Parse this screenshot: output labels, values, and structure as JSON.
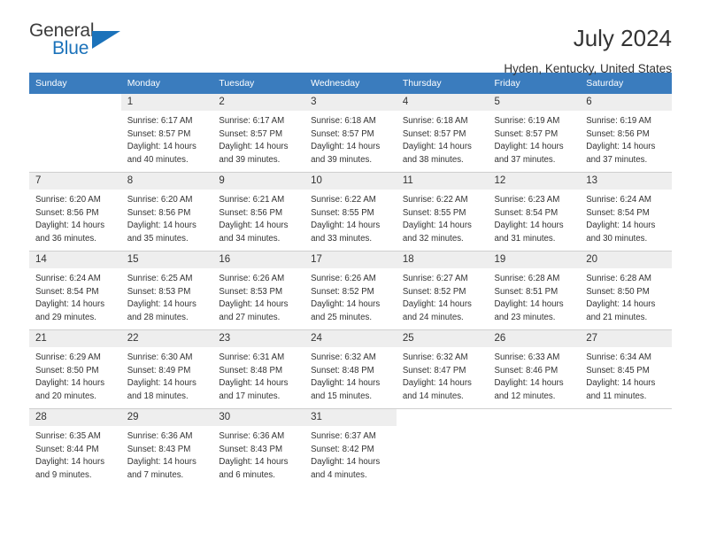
{
  "brand": {
    "name_part1": "General",
    "name_part2": "Blue",
    "triangle_color": "#1b72ba"
  },
  "header": {
    "title": "July 2024",
    "subtitle": "Hyden, Kentucky, United States"
  },
  "theme": {
    "header_bar_color": "#3a7cbe",
    "daynum_bg": "#eeeeee",
    "text_color": "#333333"
  },
  "weekday_headers": [
    "Sunday",
    "Monday",
    "Tuesday",
    "Wednesday",
    "Thursday",
    "Friday",
    "Saturday"
  ],
  "weeks": [
    [
      {
        "day": "",
        "sunrise": "",
        "sunset": "",
        "daylight1": "",
        "daylight2": ""
      },
      {
        "day": "1",
        "sunrise": "Sunrise: 6:17 AM",
        "sunset": "Sunset: 8:57 PM",
        "daylight1": "Daylight: 14 hours",
        "daylight2": "and 40 minutes."
      },
      {
        "day": "2",
        "sunrise": "Sunrise: 6:17 AM",
        "sunset": "Sunset: 8:57 PM",
        "daylight1": "Daylight: 14 hours",
        "daylight2": "and 39 minutes."
      },
      {
        "day": "3",
        "sunrise": "Sunrise: 6:18 AM",
        "sunset": "Sunset: 8:57 PM",
        "daylight1": "Daylight: 14 hours",
        "daylight2": "and 39 minutes."
      },
      {
        "day": "4",
        "sunrise": "Sunrise: 6:18 AM",
        "sunset": "Sunset: 8:57 PM",
        "daylight1": "Daylight: 14 hours",
        "daylight2": "and 38 minutes."
      },
      {
        "day": "5",
        "sunrise": "Sunrise: 6:19 AM",
        "sunset": "Sunset: 8:57 PM",
        "daylight1": "Daylight: 14 hours",
        "daylight2": "and 37 minutes."
      },
      {
        "day": "6",
        "sunrise": "Sunrise: 6:19 AM",
        "sunset": "Sunset: 8:56 PM",
        "daylight1": "Daylight: 14 hours",
        "daylight2": "and 37 minutes."
      }
    ],
    [
      {
        "day": "7",
        "sunrise": "Sunrise: 6:20 AM",
        "sunset": "Sunset: 8:56 PM",
        "daylight1": "Daylight: 14 hours",
        "daylight2": "and 36 minutes."
      },
      {
        "day": "8",
        "sunrise": "Sunrise: 6:20 AM",
        "sunset": "Sunset: 8:56 PM",
        "daylight1": "Daylight: 14 hours",
        "daylight2": "and 35 minutes."
      },
      {
        "day": "9",
        "sunrise": "Sunrise: 6:21 AM",
        "sunset": "Sunset: 8:56 PM",
        "daylight1": "Daylight: 14 hours",
        "daylight2": "and 34 minutes."
      },
      {
        "day": "10",
        "sunrise": "Sunrise: 6:22 AM",
        "sunset": "Sunset: 8:55 PM",
        "daylight1": "Daylight: 14 hours",
        "daylight2": "and 33 minutes."
      },
      {
        "day": "11",
        "sunrise": "Sunrise: 6:22 AM",
        "sunset": "Sunset: 8:55 PM",
        "daylight1": "Daylight: 14 hours",
        "daylight2": "and 32 minutes."
      },
      {
        "day": "12",
        "sunrise": "Sunrise: 6:23 AM",
        "sunset": "Sunset: 8:54 PM",
        "daylight1": "Daylight: 14 hours",
        "daylight2": "and 31 minutes."
      },
      {
        "day": "13",
        "sunrise": "Sunrise: 6:24 AM",
        "sunset": "Sunset: 8:54 PM",
        "daylight1": "Daylight: 14 hours",
        "daylight2": "and 30 minutes."
      }
    ],
    [
      {
        "day": "14",
        "sunrise": "Sunrise: 6:24 AM",
        "sunset": "Sunset: 8:54 PM",
        "daylight1": "Daylight: 14 hours",
        "daylight2": "and 29 minutes."
      },
      {
        "day": "15",
        "sunrise": "Sunrise: 6:25 AM",
        "sunset": "Sunset: 8:53 PM",
        "daylight1": "Daylight: 14 hours",
        "daylight2": "and 28 minutes."
      },
      {
        "day": "16",
        "sunrise": "Sunrise: 6:26 AM",
        "sunset": "Sunset: 8:53 PM",
        "daylight1": "Daylight: 14 hours",
        "daylight2": "and 27 minutes."
      },
      {
        "day": "17",
        "sunrise": "Sunrise: 6:26 AM",
        "sunset": "Sunset: 8:52 PM",
        "daylight1": "Daylight: 14 hours",
        "daylight2": "and 25 minutes."
      },
      {
        "day": "18",
        "sunrise": "Sunrise: 6:27 AM",
        "sunset": "Sunset: 8:52 PM",
        "daylight1": "Daylight: 14 hours",
        "daylight2": "and 24 minutes."
      },
      {
        "day": "19",
        "sunrise": "Sunrise: 6:28 AM",
        "sunset": "Sunset: 8:51 PM",
        "daylight1": "Daylight: 14 hours",
        "daylight2": "and 23 minutes."
      },
      {
        "day": "20",
        "sunrise": "Sunrise: 6:28 AM",
        "sunset": "Sunset: 8:50 PM",
        "daylight1": "Daylight: 14 hours",
        "daylight2": "and 21 minutes."
      }
    ],
    [
      {
        "day": "21",
        "sunrise": "Sunrise: 6:29 AM",
        "sunset": "Sunset: 8:50 PM",
        "daylight1": "Daylight: 14 hours",
        "daylight2": "and 20 minutes."
      },
      {
        "day": "22",
        "sunrise": "Sunrise: 6:30 AM",
        "sunset": "Sunset: 8:49 PM",
        "daylight1": "Daylight: 14 hours",
        "daylight2": "and 18 minutes."
      },
      {
        "day": "23",
        "sunrise": "Sunrise: 6:31 AM",
        "sunset": "Sunset: 8:48 PM",
        "daylight1": "Daylight: 14 hours",
        "daylight2": "and 17 minutes."
      },
      {
        "day": "24",
        "sunrise": "Sunrise: 6:32 AM",
        "sunset": "Sunset: 8:48 PM",
        "daylight1": "Daylight: 14 hours",
        "daylight2": "and 15 minutes."
      },
      {
        "day": "25",
        "sunrise": "Sunrise: 6:32 AM",
        "sunset": "Sunset: 8:47 PM",
        "daylight1": "Daylight: 14 hours",
        "daylight2": "and 14 minutes."
      },
      {
        "day": "26",
        "sunrise": "Sunrise: 6:33 AM",
        "sunset": "Sunset: 8:46 PM",
        "daylight1": "Daylight: 14 hours",
        "daylight2": "and 12 minutes."
      },
      {
        "day": "27",
        "sunrise": "Sunrise: 6:34 AM",
        "sunset": "Sunset: 8:45 PM",
        "daylight1": "Daylight: 14 hours",
        "daylight2": "and 11 minutes."
      }
    ],
    [
      {
        "day": "28",
        "sunrise": "Sunrise: 6:35 AM",
        "sunset": "Sunset: 8:44 PM",
        "daylight1": "Daylight: 14 hours",
        "daylight2": "and 9 minutes."
      },
      {
        "day": "29",
        "sunrise": "Sunrise: 6:36 AM",
        "sunset": "Sunset: 8:43 PM",
        "daylight1": "Daylight: 14 hours",
        "daylight2": "and 7 minutes."
      },
      {
        "day": "30",
        "sunrise": "Sunrise: 6:36 AM",
        "sunset": "Sunset: 8:43 PM",
        "daylight1": "Daylight: 14 hours",
        "daylight2": "and 6 minutes."
      },
      {
        "day": "31",
        "sunrise": "Sunrise: 6:37 AM",
        "sunset": "Sunset: 8:42 PM",
        "daylight1": "Daylight: 14 hours",
        "daylight2": "and 4 minutes."
      },
      {
        "day": "",
        "sunrise": "",
        "sunset": "",
        "daylight1": "",
        "daylight2": ""
      },
      {
        "day": "",
        "sunrise": "",
        "sunset": "",
        "daylight1": "",
        "daylight2": ""
      },
      {
        "day": "",
        "sunrise": "",
        "sunset": "",
        "daylight1": "",
        "daylight2": ""
      }
    ]
  ]
}
